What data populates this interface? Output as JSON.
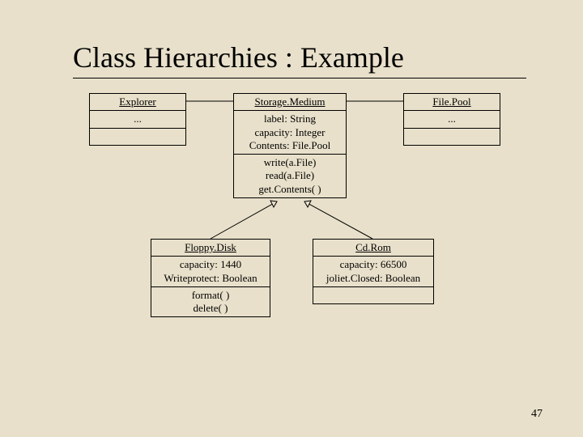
{
  "title": "Class Hierarchies : Example",
  "slide_number": "47",
  "classes": {
    "explorer": {
      "name": "Explorer",
      "attrs": "...",
      "ops": ""
    },
    "storage_medium": {
      "name": "Storage.Medium",
      "attrs_line1": "label: String",
      "attrs_line2": "capacity: Integer",
      "attrs_line3": "Contents: File.Pool",
      "ops_line1": "write(a.File)",
      "ops_line2": "read(a.File)",
      "ops_line3": "get.Contents( )"
    },
    "file_pool": {
      "name": "File.Pool",
      "attrs": "...",
      "ops": ""
    },
    "floppy_disk": {
      "name": "Floppy.Disk",
      "attrs_line1": "capacity: 1440",
      "attrs_line2": "Writeprotect: Boolean",
      "ops_line1": "format( )",
      "ops_line2": "delete( )"
    },
    "cd_rom": {
      "name": "Cd.Rom",
      "attrs_line1": "capacity: 66500",
      "attrs_line2": "joliet.Closed: Boolean",
      "ops": ""
    }
  }
}
